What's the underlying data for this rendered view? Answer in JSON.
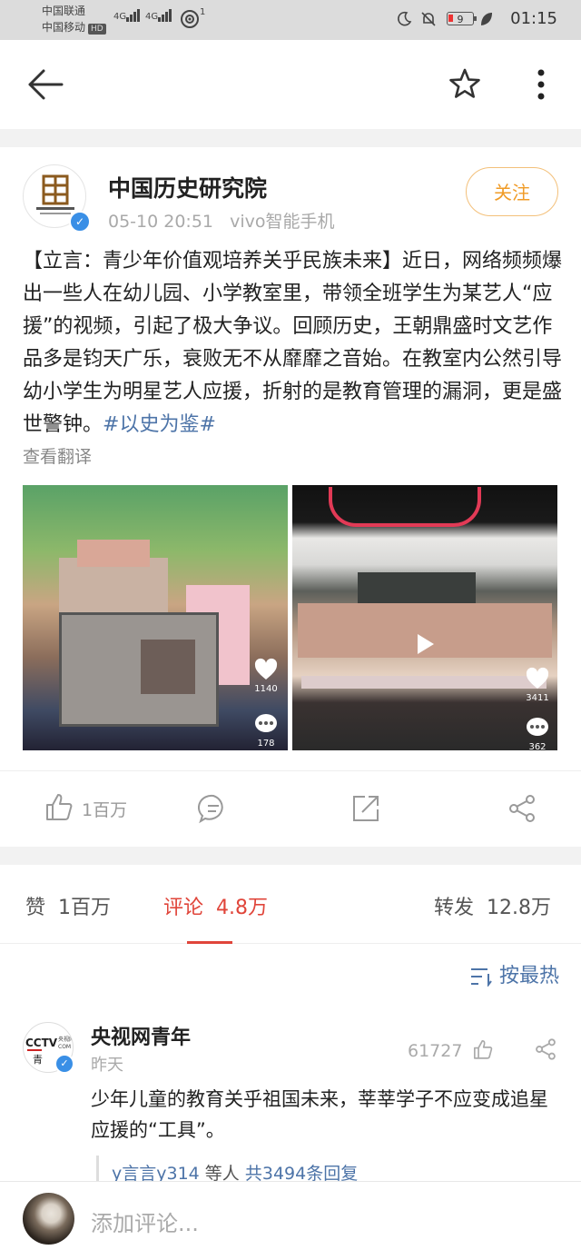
{
  "status_bar": {
    "carrier1": "中国联通",
    "carrier2": "中国移动",
    "hd": "HD",
    "net1": "4G",
    "net2": "4G",
    "wifi_count": "1",
    "battery": "9",
    "time": "01:15"
  },
  "nav": {
    "back_icon": "arrow-left-icon",
    "star_icon": "star-outline-icon",
    "more_icon": "more-vertical-icon"
  },
  "post": {
    "author": "中国历史研究院",
    "time": "05-10 20:51",
    "source": "vivo智能手机",
    "follow_label": "关注",
    "avatar_icon": "institute-logo-icon",
    "text": "【立言：青少年价值观培养关乎民族未来】近日，网络频频爆出一些人在幼儿园、小学教室里，带领全班学生为某艺人“应援”的视频，引起了极大争议。回顾历史，王朝鼎盛时文艺作品多是钧天广乐，衰败无不从靡靡之音始。在教室内公然引导幼小学生为明星艺人应援，折射的是教育管理的漏洞，更是盛世警钟。",
    "hashtag": "#以史为鉴#",
    "translate_label": "查看翻译",
    "images": [
      {
        "likes": "1140",
        "comments": "178"
      },
      {
        "likes": "3411",
        "comments": "362"
      }
    ],
    "actions": {
      "like_count": "1百万"
    }
  },
  "stats": {
    "likes_label": "赞",
    "likes_value": "1百万",
    "comments_label": "评论",
    "comments_value": "4.8万",
    "reposts_label": "转发",
    "reposts_value": "12.8万"
  },
  "sort": {
    "label": "按最热"
  },
  "comment": {
    "name": "央视网青年",
    "time": "昨天",
    "likes": "61727",
    "text": "少年儿童的教育关乎祖国未来，莘莘学子不应变成追星应援的“工具”。",
    "reply_user": "y言言y314",
    "reply_mid": " 等人 ",
    "reply_link": "共3494条回复"
  },
  "bottom": {
    "placeholder": "添加评论..."
  },
  "colors": {
    "accent_link": "#4d74a8",
    "follow": "#f09b26",
    "highlight_red": "#e0453a",
    "verified": "#3a8fe6"
  }
}
